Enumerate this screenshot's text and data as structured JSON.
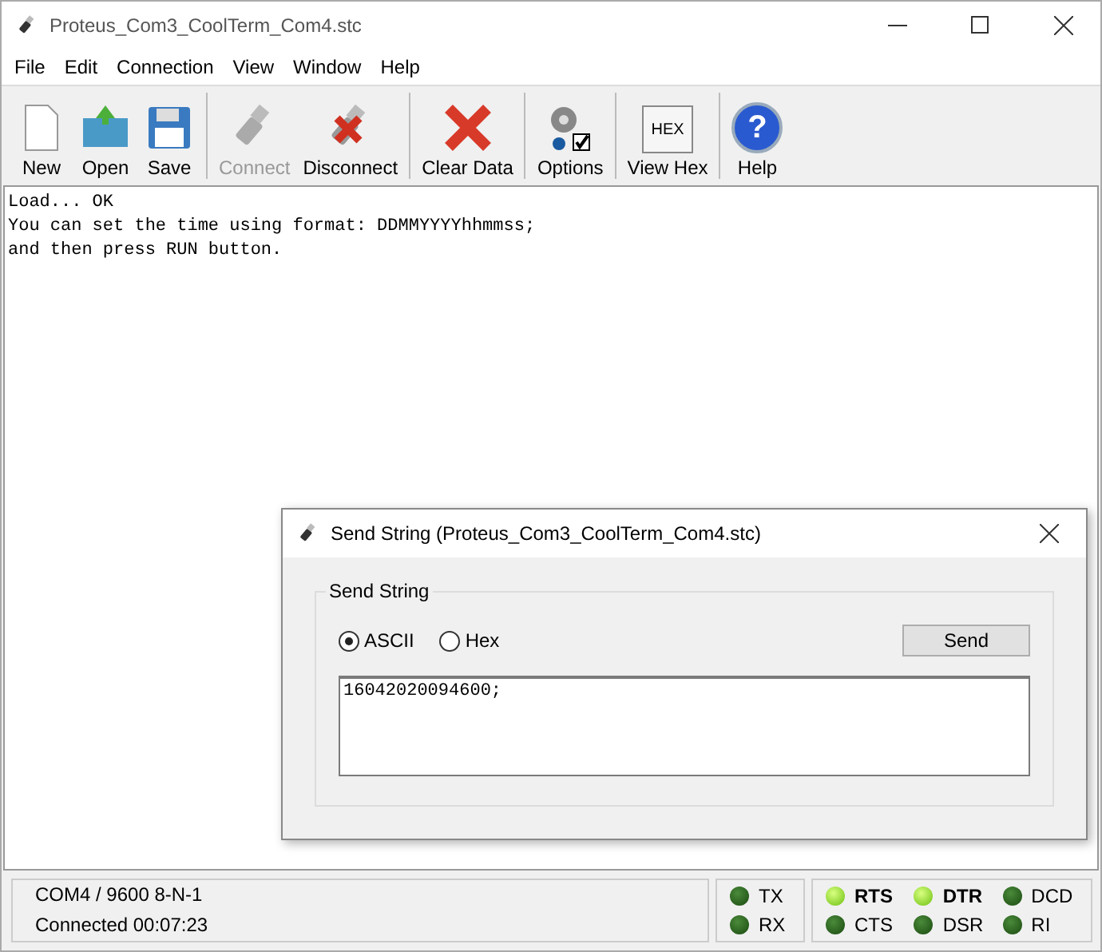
{
  "window": {
    "title": "Proteus_Com3_CoolTerm_Com4.stc"
  },
  "menu": [
    "File",
    "Edit",
    "Connection",
    "View",
    "Window",
    "Help"
  ],
  "toolbar": [
    [
      {
        "kind": "new",
        "label": "New",
        "disabled": false
      },
      {
        "kind": "open",
        "label": "Open",
        "disabled": false
      },
      {
        "kind": "save",
        "label": "Save",
        "disabled": false
      }
    ],
    [
      {
        "kind": "connect",
        "label": "Connect",
        "disabled": true
      },
      {
        "kind": "disconnect",
        "label": "Disconnect",
        "disabled": false
      }
    ],
    [
      {
        "kind": "clear",
        "label": "Clear Data",
        "disabled": false
      }
    ],
    [
      {
        "kind": "options",
        "label": "Options",
        "disabled": false
      }
    ],
    [
      {
        "kind": "hex",
        "label": "View Hex",
        "disabled": false,
        "icon_text": "HEX"
      }
    ],
    [
      {
        "kind": "help",
        "label": "Help",
        "disabled": false,
        "icon_text": "?"
      }
    ]
  ],
  "terminal": [
    "Load... OK",
    "You can set the time using format: DDMMYYYYhhmmss;",
    "and then press RUN button."
  ],
  "dialog": {
    "title": "Send String (Proteus_Com3_CoolTerm_Com4.stc)",
    "group": "Send String",
    "modes": [
      {
        "label": "ASCII",
        "selected": true
      },
      {
        "label": "Hex",
        "selected": false
      }
    ],
    "button": "Send",
    "value": "16042020094600;"
  },
  "status": {
    "port": "COM4 / 9600 8-N-1",
    "connection": "Connected 00:07:23",
    "data_lamps": [
      {
        "label": "TX",
        "on": false
      },
      {
        "label": "RX",
        "on": false
      }
    ],
    "line_lamps": [
      {
        "label": "RTS",
        "on": true
      },
      {
        "label": "DTR",
        "on": true
      },
      {
        "label": "DCD",
        "on": false
      },
      {
        "label": "CTS",
        "on": false
      },
      {
        "label": "DSR",
        "on": false
      },
      {
        "label": "RI",
        "on": false
      }
    ]
  }
}
